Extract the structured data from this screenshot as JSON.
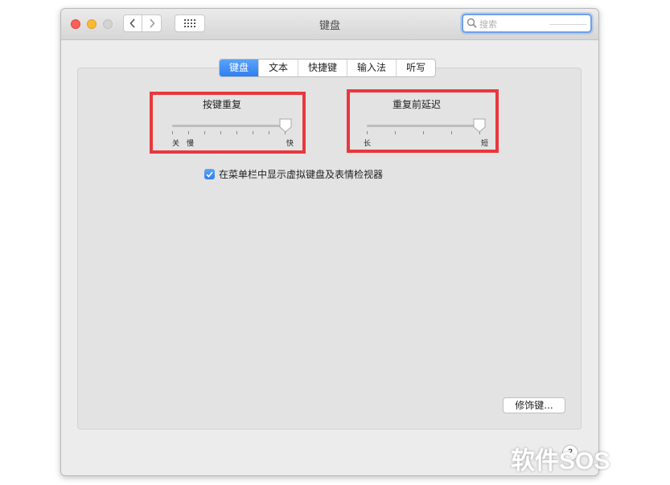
{
  "window": {
    "title": "键盘"
  },
  "search": {
    "placeholder": "搜索"
  },
  "tabs": [
    "键盘",
    "文本",
    "快捷键",
    "输入法",
    "听写"
  ],
  "active_tab": "键盘",
  "key_repeat": {
    "label": "按键重复",
    "min_label": "关",
    "slow_label": "慢",
    "max_label": "快",
    "value_fraction": 1.0
  },
  "repeat_delay": {
    "label": "重复前延迟",
    "min_label": "长",
    "max_label": "短",
    "value_fraction": 1.0
  },
  "show_viewer_checkbox": {
    "label": "在菜单栏中显示虚拟键盘及表情检视器",
    "checked": true
  },
  "modifier_button": {
    "label": "修饰键..."
  },
  "help_button": {
    "label": "?"
  },
  "watermark": {
    "text": "软件SOS"
  },
  "colors": {
    "accent": "#2f7ff0",
    "highlight_box": "#e8383d"
  }
}
